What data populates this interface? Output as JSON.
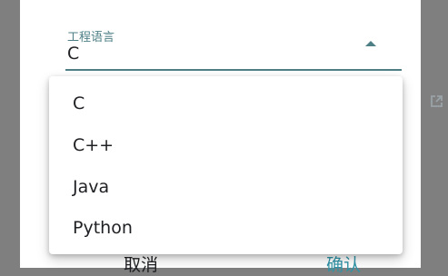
{
  "dialog": {
    "field": {
      "label": "工程语言",
      "value": "C",
      "caret_icon": "caret-up-icon"
    },
    "dropdown": {
      "options": [
        "C",
        "C++",
        "Java",
        "Python"
      ]
    },
    "buttons": {
      "cancel": "取消",
      "confirm": "确认"
    }
  },
  "background": {
    "side_icon": "open-in-new-icon"
  },
  "colors": {
    "accent": "#4e7f86",
    "confirm_text": "#2f95a8",
    "overlay": "#7f7f7f",
    "surface": "#ffffff",
    "text": "#202124"
  }
}
